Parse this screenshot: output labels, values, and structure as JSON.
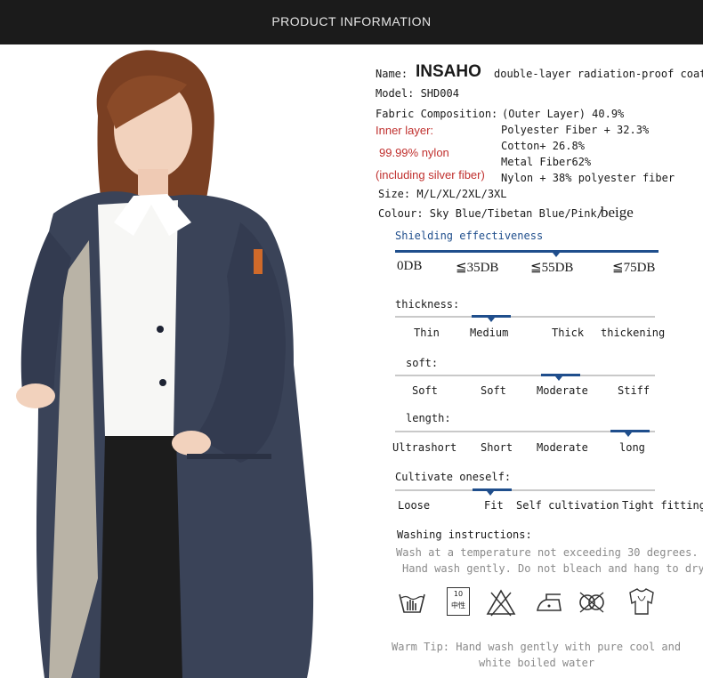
{
  "header": {
    "title": "PRODUCT INFORMATION"
  },
  "product": {
    "name_label": "Name:",
    "brand": "INSAHO",
    "name_rest": "double-layer radiation-proof coat",
    "model": "Model: SHD004",
    "fabric_label": "Fabric Composition:",
    "fabric_lines": [
      "(Outer Layer) 40.9%",
      "Polyester Fiber + 32.3%",
      "Cotton+ 26.8%",
      "Metal Fiber62%",
      "Nylon + 38% polyester fiber"
    ],
    "inner_lines": [
      "Inner layer:",
      "99.99% nylon",
      "(including silver fiber)"
    ],
    "size": "Size: M/L/XL/2XL/3XL",
    "colour": "Colour: Sky Blue/Tibetan Blue/Pink/",
    "colour_last": "beige"
  },
  "shielding": {
    "title": "Shielding effectiveness",
    "scale": [
      "0DB",
      "≦35DB",
      "≦55DB",
      "≦75DB"
    ],
    "selected": "≦55DB"
  },
  "scales": [
    {
      "title": "thickness:",
      "options": [
        "Thin",
        "Medium",
        "Thick",
        "thickening"
      ],
      "selected": "Medium"
    },
    {
      "title": "soft:",
      "options": [
        "Soft",
        "Soft",
        "Moderate",
        "Stiff"
      ],
      "selected": "Moderate"
    },
    {
      "title": "length:",
      "options": [
        "Ultrashort",
        "Short",
        "Moderate",
        "long"
      ],
      "selected": "long"
    },
    {
      "title": "Cultivate oneself:",
      "options": [
        "Loose",
        "Fit",
        "Self cultivation",
        "Tight fitting"
      ],
      "selected": "Fit"
    }
  ],
  "washing": {
    "title": "Washing instructions:",
    "lines": [
      "Wash at a temperature not exceeding 30 degrees.",
      "Hand wash gently. Do not bleach and hang to dry."
    ],
    "icons": [
      "hand-wash-icon",
      "dry-clean-icon",
      "no-bleach-icon",
      "iron-icon",
      "no-tumble-dry-icon",
      "hang-dry-icon"
    ],
    "icon_labels": {
      "dry_clean_top": "10",
      "dry_clean_bottom": "中性"
    }
  },
  "tip": [
    "Warm Tip: Hand wash gently with pure cool and",
    "white boiled water"
  ],
  "colors": {
    "banner": "#1b1b1b",
    "accent": "#1f4e8c",
    "red_text": "#c0302e",
    "coat": "#3a4358"
  }
}
